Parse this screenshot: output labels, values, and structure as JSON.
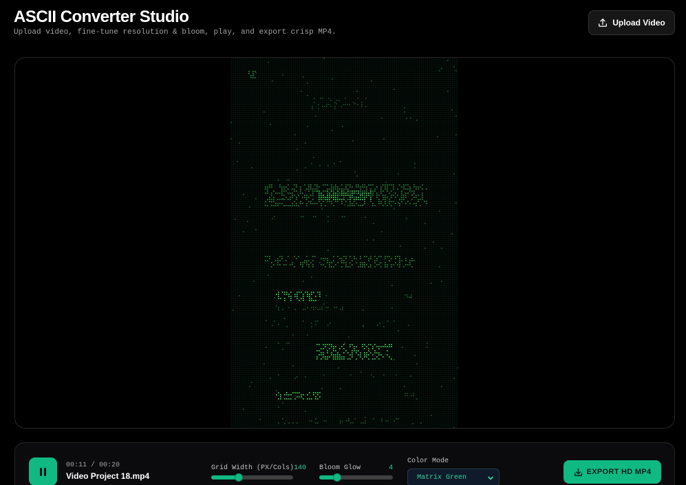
{
  "header": {
    "title": "ASCII Converter Studio",
    "subtitle": "Upload video, fine-tune resolution & bloom, play, and export crisp MP4.",
    "upload_label": "Upload Video"
  },
  "player": {
    "time": "00:11 / 00:20",
    "file_name": "Video Project 18.mp4",
    "state": "playing"
  },
  "controls": {
    "grid_width": {
      "label": "Grid Width (PX/Cols)",
      "value": "140",
      "fraction": 0.34
    },
    "bloom_glow": {
      "label": "Bloom Glow",
      "value": "4",
      "fraction": 0.24
    },
    "color_mode": {
      "label": "Color Mode",
      "selected": "Matrix Green"
    },
    "export_label": "EXPORT HD MP4"
  },
  "colors": {
    "accent": "#10b981",
    "ascii_green": "#22c55e",
    "background": "#000000"
  }
}
